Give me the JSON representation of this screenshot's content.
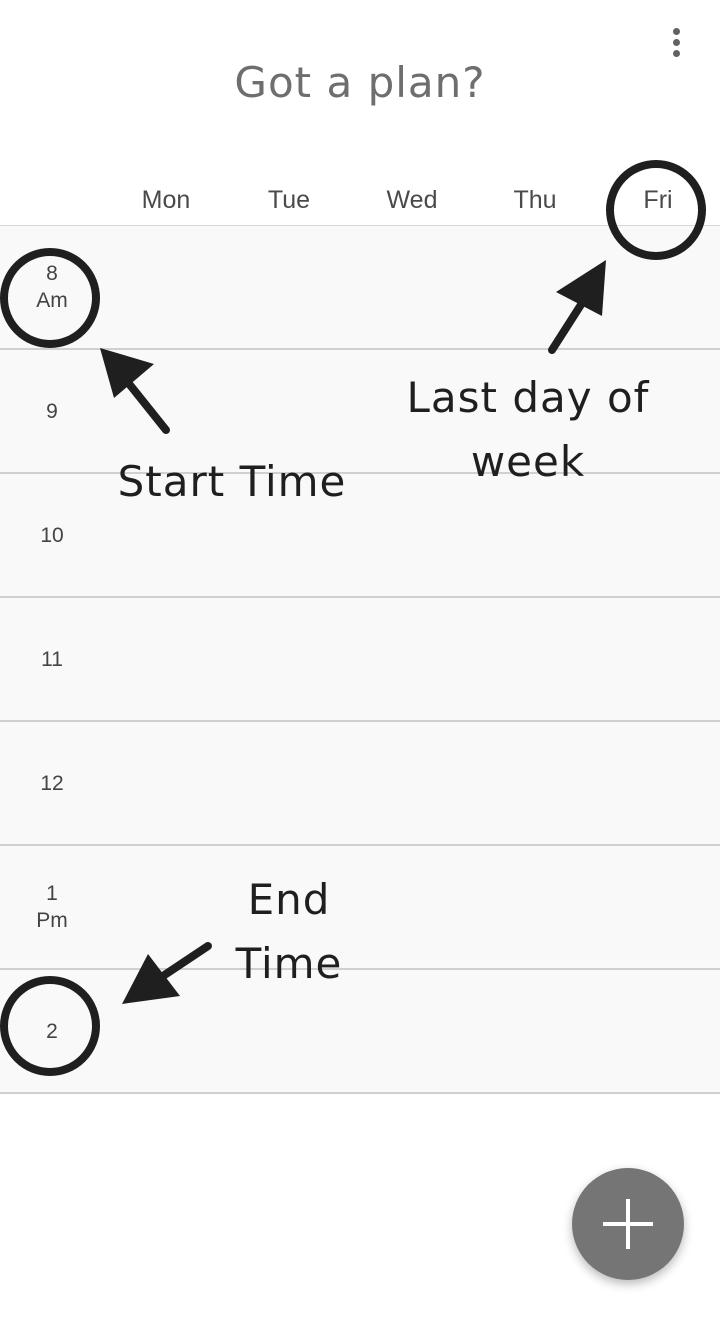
{
  "app": {
    "title": "Got a plan?",
    "menu_icon": "more-vert-icon"
  },
  "days": [
    "Mon",
    "Tue",
    "Wed",
    "Thu",
    "Fri"
  ],
  "times": [
    {
      "hour": "8",
      "period": "Am"
    },
    {
      "hour": "9",
      "period": ""
    },
    {
      "hour": "10",
      "period": ""
    },
    {
      "hour": "11",
      "period": ""
    },
    {
      "hour": "12",
      "period": ""
    },
    {
      "hour": "1",
      "period": "Pm"
    },
    {
      "hour": "2",
      "period": ""
    }
  ],
  "annotations": {
    "start_time": "Start Time",
    "last_day_line1": "Last day of",
    "last_day_line2": "week",
    "end_time": "End Time"
  },
  "fab": {
    "icon": "plus-icon"
  },
  "colors": {
    "fab": "#757575",
    "row_background": "#f9f9f9",
    "row_divider": "#d0d0d0",
    "annotation": "#1f1f1f"
  }
}
